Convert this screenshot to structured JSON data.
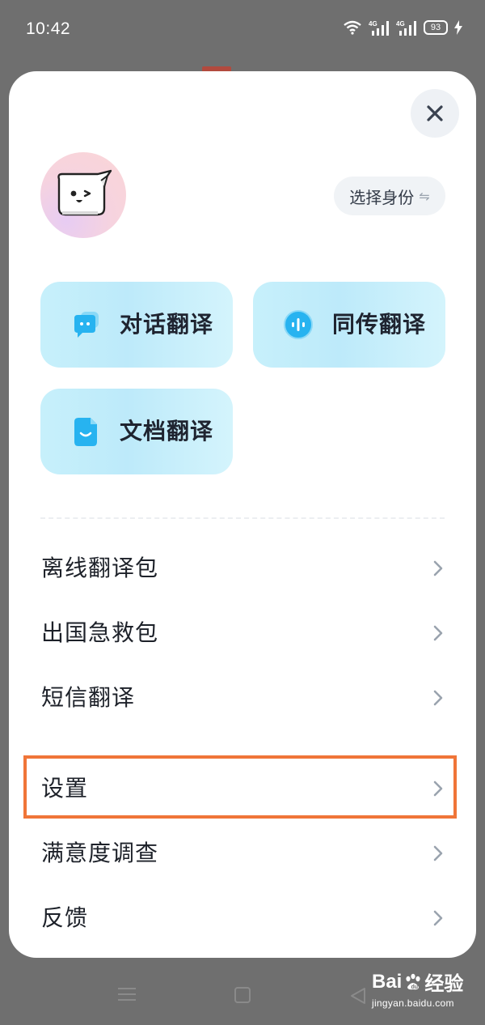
{
  "status_bar": {
    "time": "10:42",
    "battery": "93",
    "network_labels": [
      "4G",
      "4G"
    ]
  },
  "identity_button": {
    "label": "选择身份",
    "swap_symbol": "⇋"
  },
  "feature_tiles": [
    {
      "label": "对话翻译",
      "icon": "chat-bubble-icon"
    },
    {
      "label": "同传翻译",
      "icon": "voice-wave-icon"
    },
    {
      "label": "文档翻译",
      "icon": "document-icon"
    }
  ],
  "menu_items": [
    {
      "label": "离线翻译包"
    },
    {
      "label": "出国急救包"
    },
    {
      "label": "短信翻译"
    },
    {
      "label": "设置",
      "highlighted": true
    },
    {
      "label": "满意度调查"
    },
    {
      "label": "反馈"
    }
  ],
  "watermark": {
    "brand": "Bai",
    "brand_suffix": "经验",
    "url": "jingyan.baidu.com"
  },
  "colors": {
    "tile_bg": "#c7f0fb",
    "icon_blue": "#27b3f0",
    "highlight": "#f07538",
    "chevron": "#9aa3ae"
  }
}
